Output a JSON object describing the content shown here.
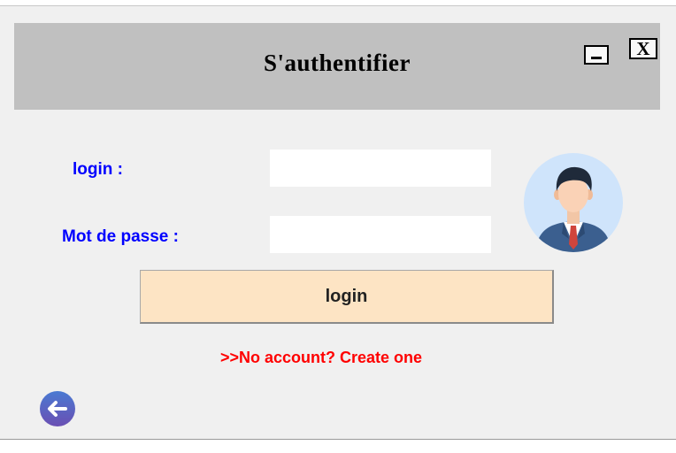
{
  "window": {
    "title": "S'authentifier",
    "close_label": "X"
  },
  "form": {
    "login_label": "login :",
    "login_value": "",
    "password_label": "Mot de passe :",
    "password_value": "",
    "submit_label": "login",
    "create_account_link": ">>No account? Create one"
  },
  "icons": {
    "minimize": "minimize-icon",
    "close": "close-icon",
    "avatar": "user-avatar-icon",
    "back": "back-arrow-icon"
  },
  "colors": {
    "title_bar": "#c0c0c0",
    "background": "#f0f0f0",
    "label": "#0000ff",
    "button": "#fde4c4",
    "link": "#ff0000",
    "back_icon": "#3e62b8"
  }
}
